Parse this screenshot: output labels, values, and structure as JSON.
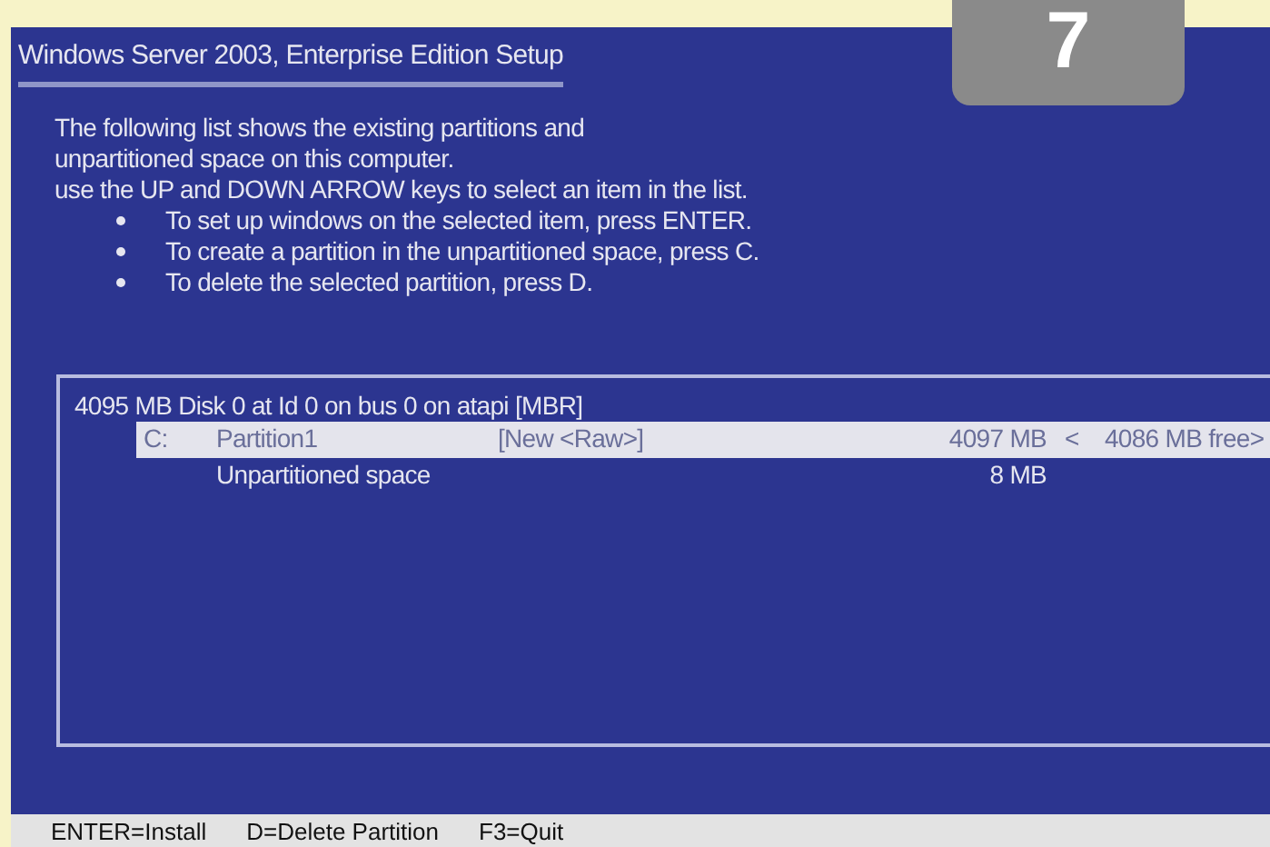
{
  "step_badge": {
    "label": "7"
  },
  "window": {
    "title": "Windows Server 2003, Enterprise Edition Setup"
  },
  "intro": [
    "The following list shows the existing partitions and",
    "unpartitioned space on this computer.",
    "use the UP and DOWN ARROW keys to select an item in the list."
  ],
  "bullets": [
    "To set up windows on the selected item, press ENTER.",
    "To create a partition in the unpartitioned space, press C.",
    "To delete the selected partition, press D."
  ],
  "disk": {
    "label": "4095 MB Disk 0 at Id 0 on bus 0 on atapi [MBR]"
  },
  "partitions": [
    {
      "drive": "C:",
      "name": "Partition1",
      "type": "[New <Raw>]",
      "size": "4097 MB",
      "free": "<    4086 MB free>",
      "selected": true
    },
    {
      "name": "Unpartitioned space",
      "size": "8 MB",
      "selected": false
    }
  ],
  "status_bar": [
    "ENTER=Install",
    "D=Delete Partition",
    "F3=Quit"
  ]
}
